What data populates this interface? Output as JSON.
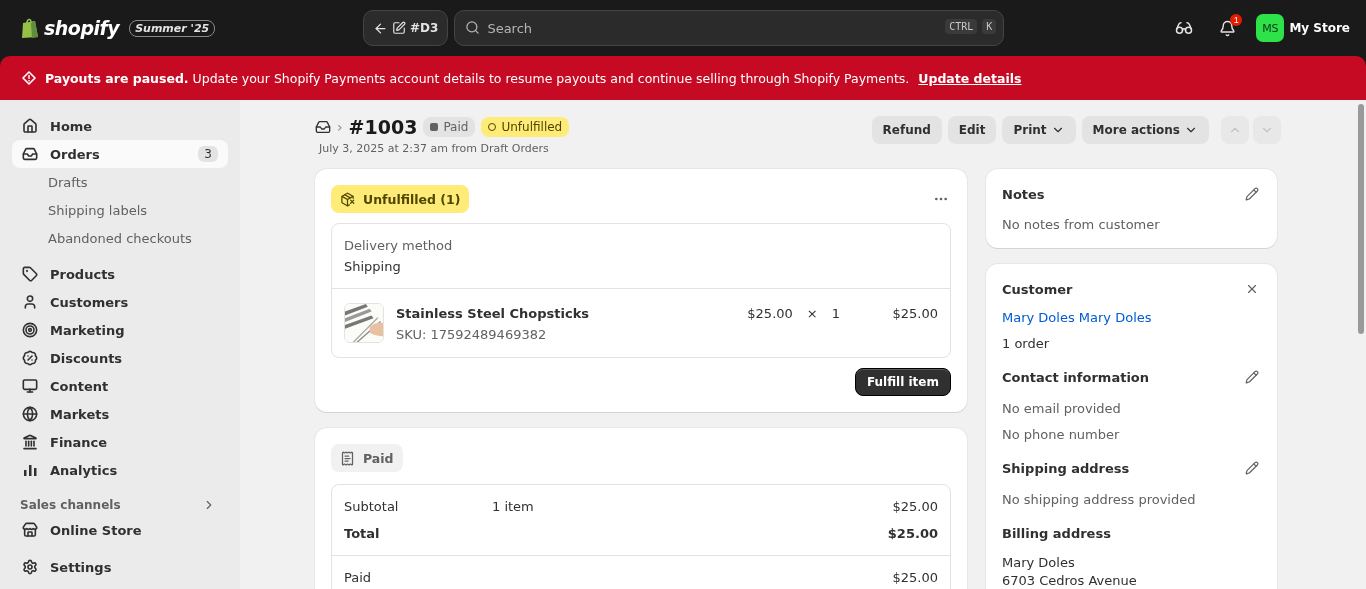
{
  "topbar": {
    "brand": "shopify",
    "edition": "Summer '25",
    "back_label": "#D3",
    "search": {
      "placeholder": "Search",
      "keys": [
        "CTRL",
        "K"
      ]
    },
    "notifications": "1",
    "store": {
      "initials": "MS",
      "name": "My Store",
      "color": "#2ee24a"
    }
  },
  "banner": {
    "text": "**Payouts are paused.** Update your Shopify Payments account details to resume payouts and continue selling through Shopify Payments.",
    "link": "Update details"
  },
  "sidebar": {
    "items": [
      {
        "label": "Home",
        "selected": false
      },
      {
        "label": "Orders",
        "selected": true,
        "count": "3",
        "children": [
          {
            "label": "Drafts",
            "selected": false
          },
          {
            "label": "Shipping labels",
            "selected": false
          },
          {
            "label": "Abandoned checkouts",
            "selected": false
          }
        ]
      },
      {
        "label": "Products",
        "selected": false
      },
      {
        "label": "Customers",
        "selected": false
      },
      {
        "label": "Marketing",
        "selected": false
      },
      {
        "label": "Discounts",
        "selected": false
      },
      {
        "label": "Content",
        "selected": false
      },
      {
        "label": "Markets",
        "selected": false
      },
      {
        "label": "Finance",
        "selected": false
      },
      {
        "label": "Analytics",
        "selected": false
      }
    ],
    "section": "Sales channels",
    "channels": [
      {
        "label": "Online Store",
        "selected": false
      }
    ],
    "settings": {
      "label": "Settings",
      "selected": false
    }
  },
  "order": {
    "breadcrumb_separator": "›",
    "number": "#1003",
    "badges": [
      {
        "label": "Paid",
        "kind": "neutral"
      },
      {
        "label": "Unfulfilled",
        "kind": "warning"
      }
    ],
    "subtitle": "July 3, 2025 at 2:37 am from Draft Orders",
    "actions": [
      {
        "label": "Refund",
        "dropdown": false
      },
      {
        "label": "Edit",
        "dropdown": false
      },
      {
        "label": "Print",
        "dropdown": true
      },
      {
        "label": "More actions",
        "dropdown": true
      }
    ]
  },
  "fulfillment": {
    "status": "Unfulfilled (1)",
    "delivery_label": "Delivery method",
    "delivery_value": "Shipping",
    "items": [
      {
        "name": "Stainless Steel Chopsticks",
        "sku": "SKU: 17592489469382",
        "price": "$25.00",
        "times": "×",
        "qty": "1",
        "total": "$25.00"
      }
    ],
    "button": "Fulfill item"
  },
  "payment": {
    "status": "Paid",
    "rows": [
      {
        "label": "Subtotal",
        "detail": "1 item",
        "amount": "$25.00",
        "bold": false
      },
      {
        "label": "Total",
        "amount": "$25.00",
        "bold": true
      }
    ],
    "paid_rows": [
      {
        "label": "Paid",
        "amount": "$25.00"
      }
    ]
  },
  "notes": {
    "title": "Notes",
    "text": "No notes from customer"
  },
  "customer": {
    "title": "Customer",
    "name": "Mary Doles Mary Doles",
    "orders": "1 order",
    "sections": [
      {
        "title": "Contact information",
        "editable": true,
        "lines": [
          "No email provided",
          "No phone number"
        ],
        "muted": true
      },
      {
        "title": "Shipping address",
        "editable": true,
        "lines": [
          "No shipping address provided"
        ],
        "muted": true
      },
      {
        "title": "Billing address",
        "editable": false,
        "lines": [
          "Mary Doles",
          "6703 Cedros Avenue"
        ],
        "muted": false
      }
    ]
  }
}
